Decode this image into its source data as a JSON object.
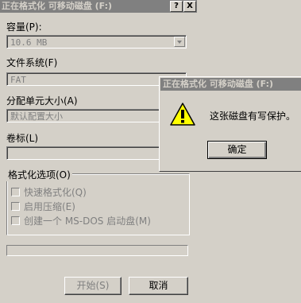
{
  "main_dialog": {
    "title": "正在格式化 可移动磁盘 (F:)",
    "help_btn": "?",
    "close_btn": "X",
    "capacity_label": "容量(P):",
    "capacity_value": "10.6 MB",
    "filesystem_label": "文件系统(F)",
    "filesystem_value": "FAT",
    "allocation_label": "分配单元大小(A)",
    "allocation_value": "默认配置大小",
    "volume_label": "卷标(L)",
    "volume_value": "",
    "options_title": "格式化选项(O)",
    "options": [
      {
        "label": "快速格式化(Q)",
        "checked": false
      },
      {
        "label": "启用压缩(E)",
        "checked": false
      },
      {
        "label": "创建一个 MS-DOS 启动盘(M)",
        "checked": false
      }
    ],
    "start_button": "开始(S)",
    "close_button": "取消"
  },
  "message_box": {
    "title": "正在格式化 可移动磁盘 (F:)",
    "message": "这张磁盘有写保护。",
    "ok_button": "确定",
    "icon": "warning-icon"
  }
}
